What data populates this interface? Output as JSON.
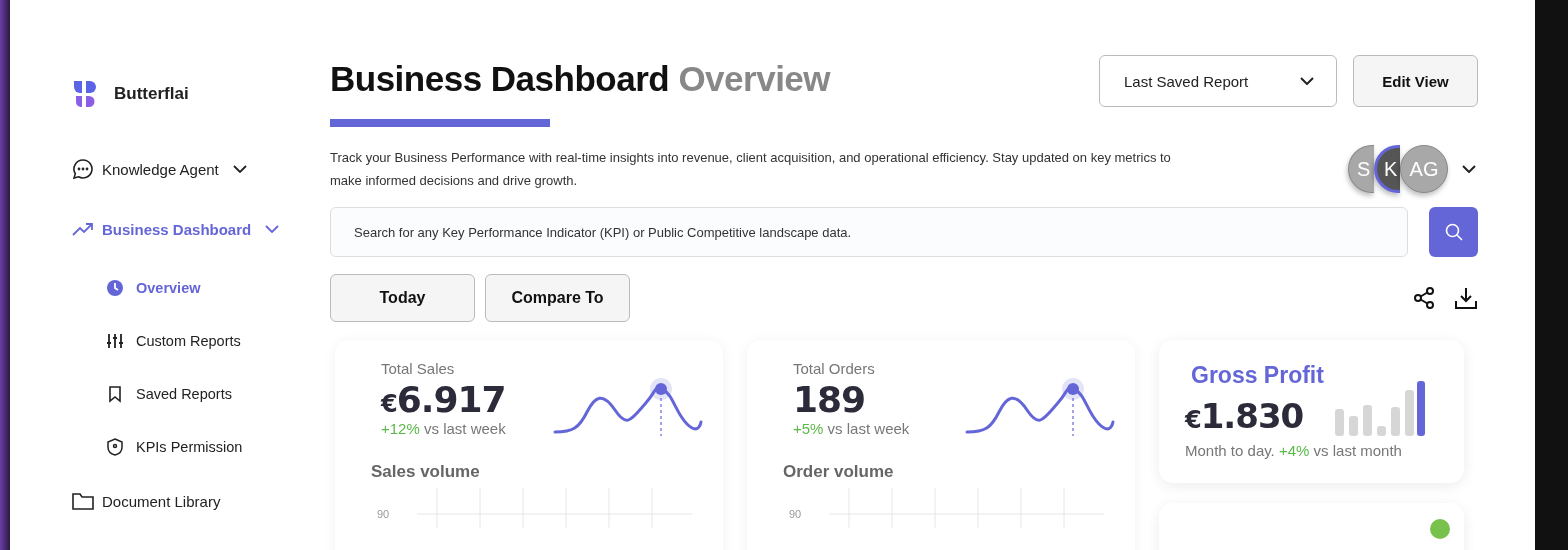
{
  "brand": {
    "name": "Butterflai"
  },
  "sidebar": {
    "items": [
      {
        "label": "Knowledge Agent",
        "selected": false
      },
      {
        "label": "Business Dashboard",
        "selected": true,
        "children": [
          {
            "label": "Overview",
            "selected": true
          },
          {
            "label": "Custom Reports",
            "selected": false
          },
          {
            "label": "Saved Reports",
            "selected": false
          },
          {
            "label": "KPIs Permission",
            "selected": false
          }
        ]
      },
      {
        "label": "Document Library",
        "selected": false
      }
    ]
  },
  "header": {
    "title": "Business Dashboard",
    "subtitle": "Overview",
    "report_select": "Last Saved Report",
    "edit_button": "Edit View",
    "description": "Track your Business Performance with real-time insights into revenue, client acquisition, and operational efficiency. Stay updated on key metrics to make informed decisions and drive growth."
  },
  "avatars": [
    {
      "initials": "S",
      "selected": false
    },
    {
      "initials": "K",
      "selected": true
    },
    {
      "initials": "AG",
      "selected": false
    }
  ],
  "search": {
    "placeholder": "Search for any Key Performance Indicator (KPI) or Public Competitive landscape data."
  },
  "period_buttons": [
    "Today",
    "Compare To"
  ],
  "kpi_cards": [
    {
      "label": "Total Sales",
      "currency": "€",
      "value": "6.917",
      "change": "+12%",
      "comparison": "vs  last week",
      "chart_title": "Sales volume",
      "y_tick": "90"
    },
    {
      "label": "Total Orders",
      "value": "189",
      "change": "+5%",
      "comparison": "vs  last week",
      "chart_title": "Order volume",
      "y_tick": "90"
    }
  ],
  "profit_card": {
    "label": "Gross Profit",
    "currency": "€",
    "value": "1.830",
    "note": "Month to day.",
    "change": "+4%",
    "comparison": "vs last month"
  },
  "margin_card": {
    "color": "#79c14d"
  }
}
